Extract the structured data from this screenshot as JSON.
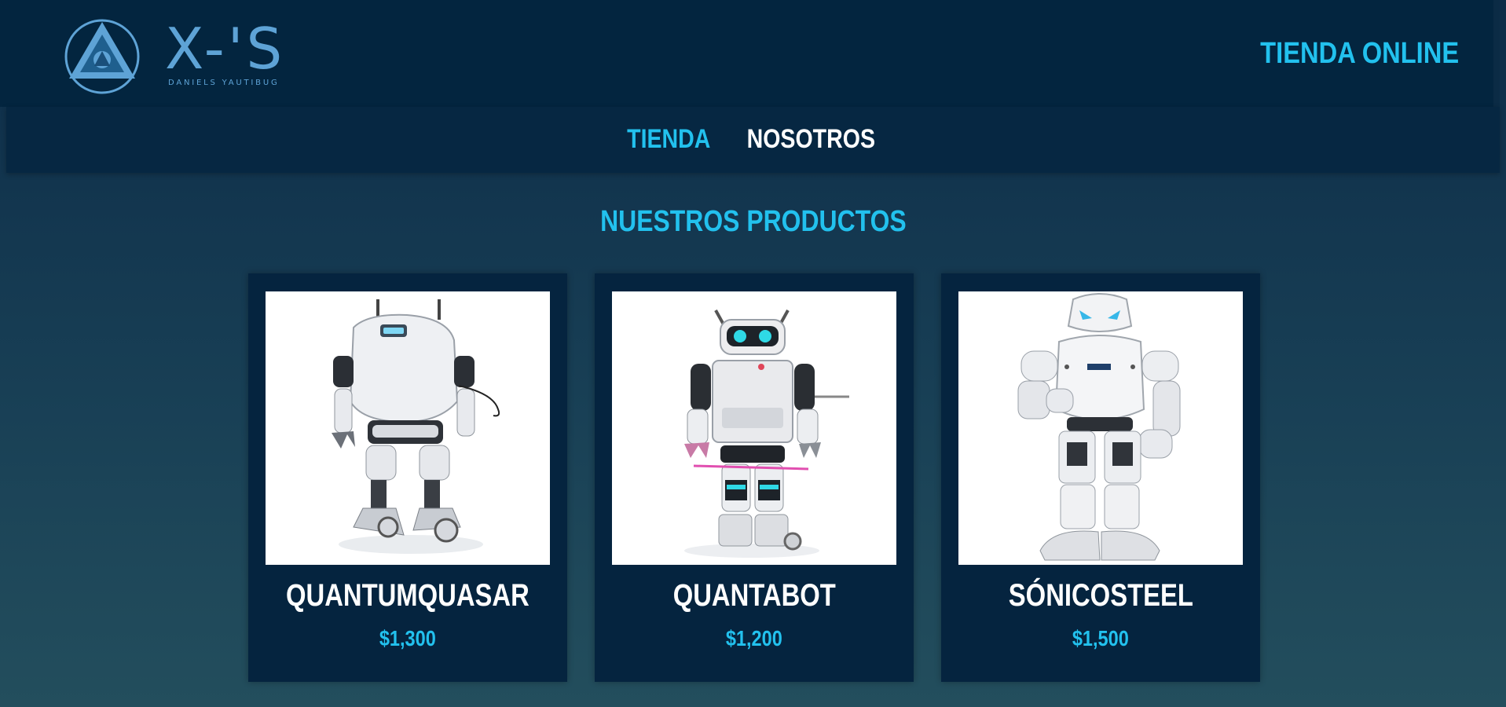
{
  "header": {
    "brand_name": "X-'S",
    "brand_subtitle": "DANIELS YAUTIBUG",
    "store_title": "TIENDA ONLINE",
    "logo_icon": "triangle-circle-logo-icon"
  },
  "nav": {
    "items": [
      {
        "label": "TIENDA",
        "active": true
      },
      {
        "label": "NOSOTROS",
        "active": false
      }
    ]
  },
  "main": {
    "section_title": "NUESTROS PRODUCTOS",
    "products": [
      {
        "name": "QUANTUMQUASAR",
        "price": "$1,300",
        "image": "robot-quantumquasar-image"
      },
      {
        "name": "QUANTABOT",
        "price": "$1,200",
        "image": "robot-quantabot-image"
      },
      {
        "name": "SÓNICOSTEEL",
        "price": "$1,500",
        "image": "robot-sonicosteel-image"
      }
    ]
  },
  "colors": {
    "accent": "#22c1ee",
    "header_bg": "#03253f",
    "card_bg": "#05243f",
    "logo": "#5ea3d6"
  }
}
